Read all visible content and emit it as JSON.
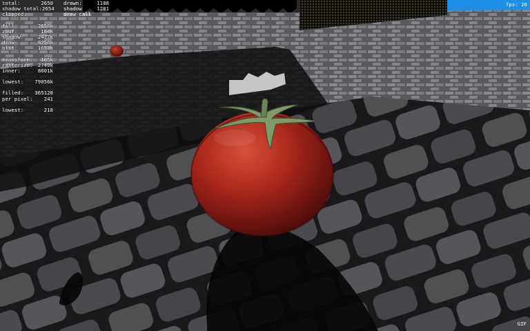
{
  "hud": {
    "col1": [
      {
        "label": "total:",
        "value": "2650"
      },
      {
        "label": "shadow total:",
        "value": "2654"
      },
      {
        "label": "clipped:",
        "value": ""
      },
      {
        "gap": true
      },
      {
        "label": "fill:",
        "value": "2656k"
      },
      {
        "label": "zbuf:",
        "value": "164k"
      },
      {
        "label": "shadow:",
        "value": "2477k"
      },
      {
        "label": "draw:",
        "value": "8756k"
      },
      {
        "label": "blit:",
        "value": "1653k"
      },
      {
        "gap": true
      },
      {
        "label": "transform:",
        "value": "105k"
      },
      {
        "label": "rasterize:",
        "value": "2740k"
      },
      {
        "label": "inner:",
        "value": "8601k"
      },
      {
        "gap": true
      },
      {
        "label": "lowest:",
        "value": "79056k"
      },
      {
        "gap": true
      },
      {
        "label": "filled:",
        "value": "365128"
      },
      {
        "label": "per pixel:",
        "value": "241"
      },
      {
        "gap": true
      },
      {
        "label": "lowest:",
        "value": "218"
      }
    ],
    "col2": [
      {
        "label": "drawn:",
        "value": "1188"
      },
      {
        "label": "shadow",
        "value": "1281"
      },
      {
        "label": "draw call",
        "value": ""
      }
    ],
    "fps": "fps: 26",
    "gif": "GIF"
  },
  "colors": {
    "sky": "#1e8fe6",
    "cobble": "#6e6e72",
    "cobble_dark": "#2c2c30",
    "shadow": "#0a0a0c",
    "tomato": "#b82418",
    "tomato_dark": "#4a0a06",
    "stem": "#6f8a5a"
  }
}
